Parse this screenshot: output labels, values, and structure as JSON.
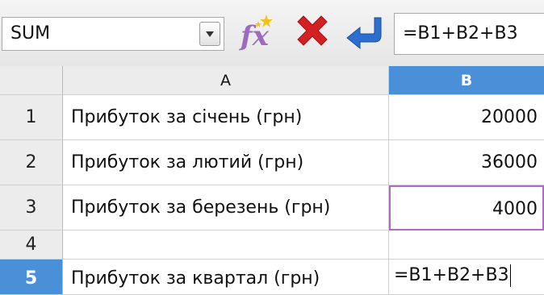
{
  "formula_bar": {
    "name_box_value": "SUM",
    "formula_text": "=B1+B2+B3"
  },
  "icons": {
    "function_wizard": "fx-icon",
    "cancel": "cancel-x-icon",
    "accept": "accept-arrow-icon"
  },
  "grid": {
    "column_headers": [
      "A",
      "B"
    ],
    "rows": [
      {
        "num": "1",
        "a": "Прибуток за січень (грн)",
        "b": "20000"
      },
      {
        "num": "2",
        "a": "Прибуток за лютий (грн)",
        "b": "36000"
      },
      {
        "num": "3",
        "a": "Прибуток за березень (грн)",
        "b": "4000"
      },
      {
        "num": "4",
        "a": "",
        "b": ""
      },
      {
        "num": "5",
        "a": "Прибуток за квартал (грн)",
        "b": "=B1+B2+B3"
      }
    ]
  },
  "colors": {
    "selection_blue": "#4a90d9",
    "reference_highlight": "#b06ac4",
    "cancel_red": "#d42020",
    "accept_blue": "#2d6fd0"
  }
}
